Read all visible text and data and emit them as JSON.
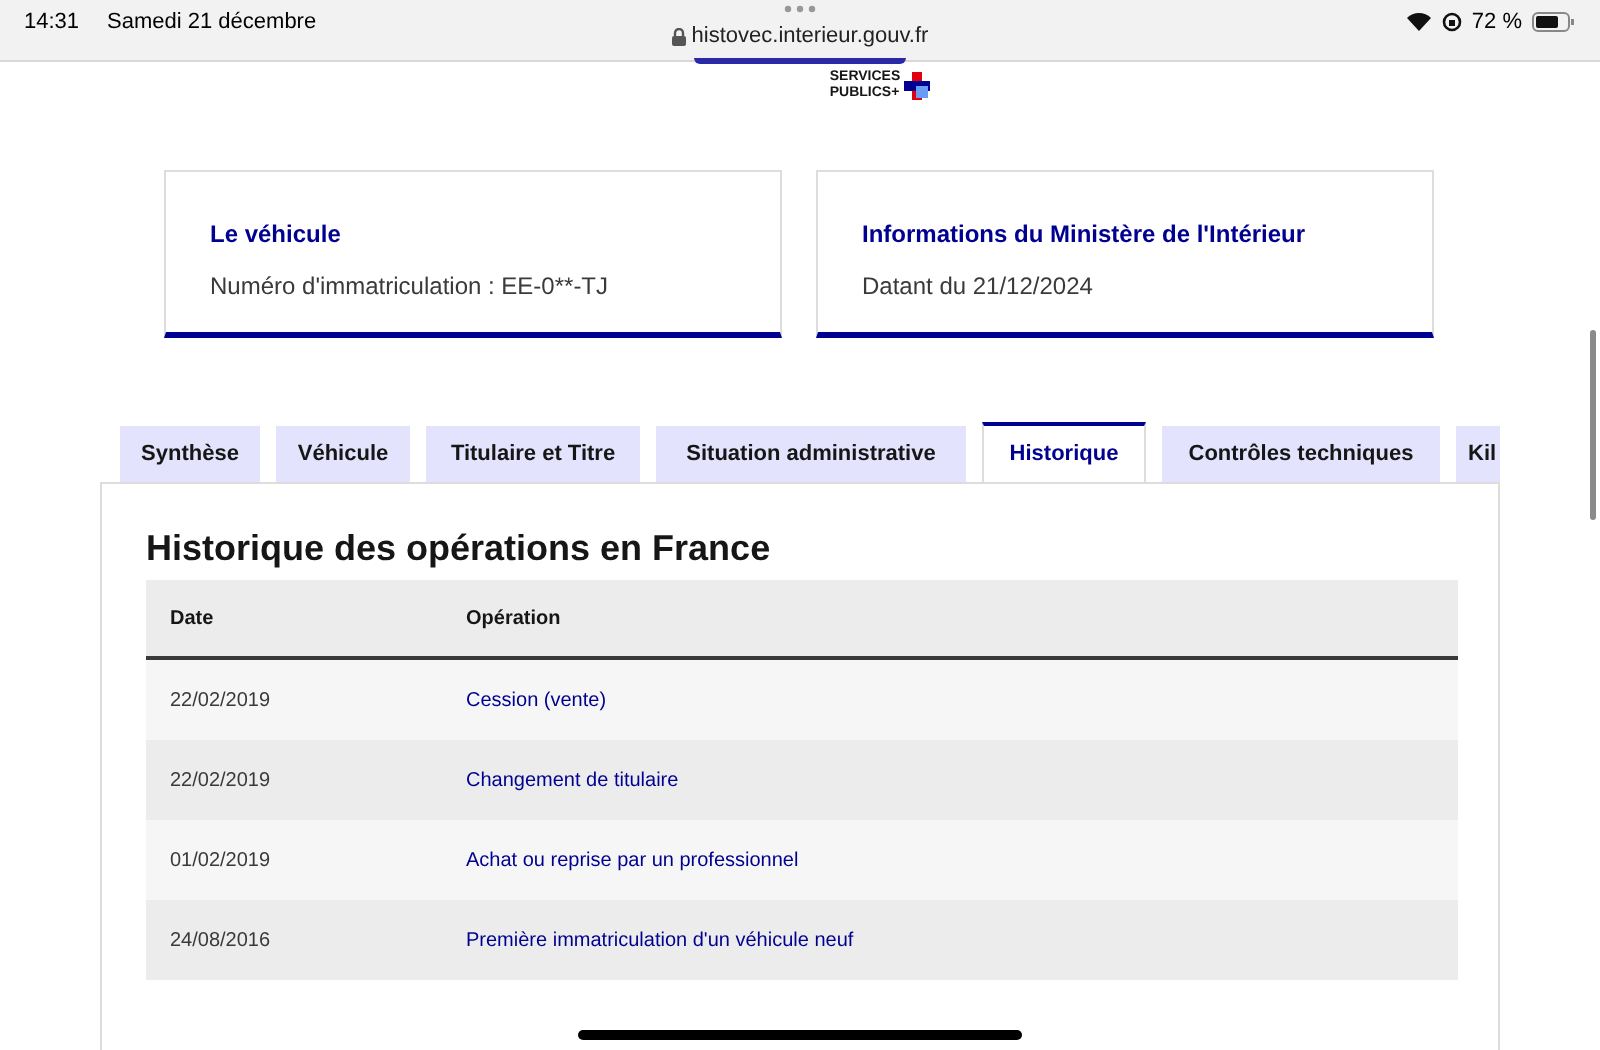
{
  "status_bar": {
    "time": "14:31",
    "date": "Samedi 21 décembre",
    "url": "histovec.interieur.gouv.fr",
    "battery": "72 %"
  },
  "logo": {
    "line1": "SERVICES",
    "line2": "PUBLICS+"
  },
  "cards": [
    {
      "title": "Le véhicule",
      "text": "Numéro d'immatriculation : EE-0**-TJ"
    },
    {
      "title": "Informations du Ministère de l'Intérieur",
      "text": "Datant du 21/12/2024"
    }
  ],
  "tabs": [
    {
      "label": "Synthèse",
      "selected": false
    },
    {
      "label": "Véhicule",
      "selected": false
    },
    {
      "label": "Titulaire et Titre",
      "selected": false
    },
    {
      "label": "Situation administrative",
      "selected": false
    },
    {
      "label": "Historique",
      "selected": true
    },
    {
      "label": "Contrôles techniques",
      "selected": false
    },
    {
      "label": "Kil",
      "selected": false
    }
  ],
  "section_title": "Historique des opérations en France",
  "table": {
    "columns": [
      "Date",
      "Opération"
    ],
    "rows": [
      {
        "date": "22/02/2019",
        "operation": "Cession (vente)"
      },
      {
        "date": "22/02/2019",
        "operation": "Changement de titulaire"
      },
      {
        "date": "01/02/2019",
        "operation": "Achat ou reprise par un professionnel"
      },
      {
        "date": "24/08/2016",
        "operation": "Première immatriculation d'un véhicule neuf"
      }
    ]
  }
}
